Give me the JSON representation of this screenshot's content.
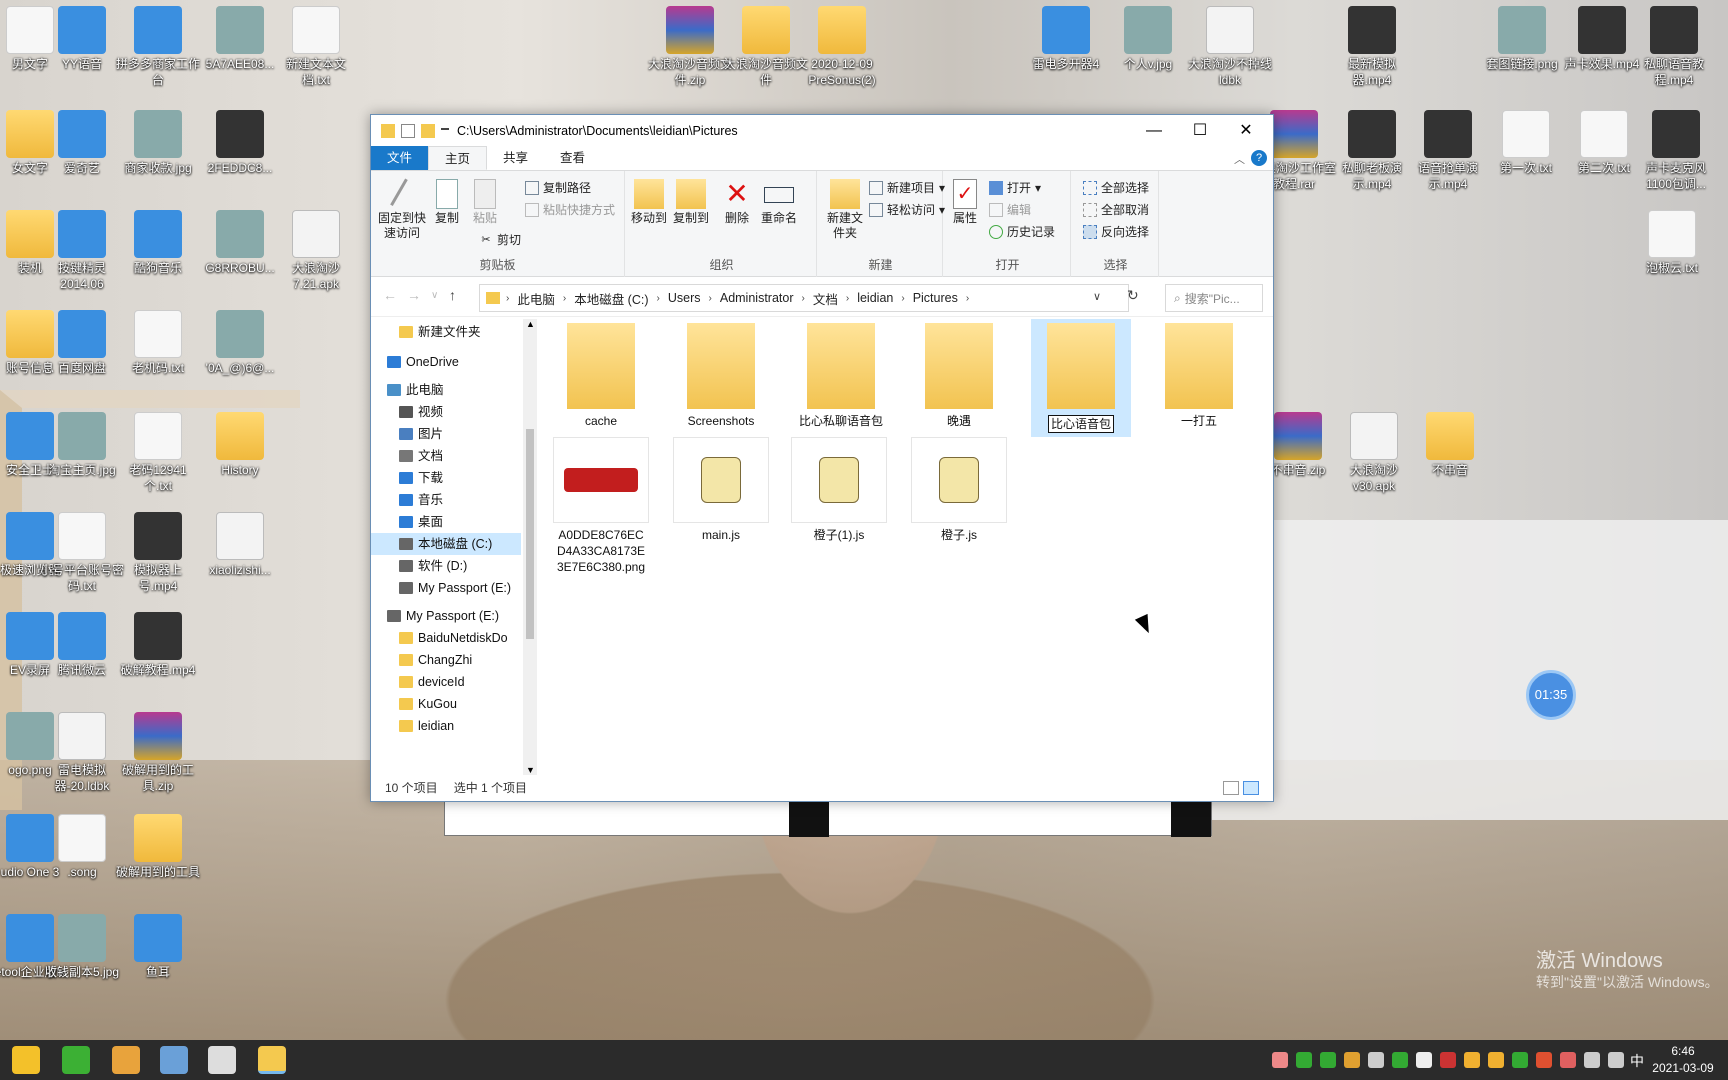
{
  "desktop": {
    "icons": [
      {
        "label": "男文字",
        "type": "doc"
      },
      {
        "label": "YY语音",
        "type": "app"
      },
      {
        "label": "拼多多商家工作台",
        "type": "app"
      },
      {
        "label": "5A7AEE08...",
        "type": "img"
      },
      {
        "label": "新建文本文档.txt",
        "type": "doc"
      },
      {
        "label": "大浪淘沙音频文件.zip",
        "type": "rar"
      },
      {
        "label": "大浪淘沙音频文件",
        "type": "folder"
      },
      {
        "label": "2020-12-09 PreSonus(2)",
        "type": "folder"
      },
      {
        "label": "雷电多开器4",
        "type": "app"
      },
      {
        "label": "个人v.jpg",
        "type": "img"
      },
      {
        "label": "大浪淘沙不掉线ldbk",
        "type": "apk"
      },
      {
        "label": "最新模拟器.mp4",
        "type": "video"
      },
      {
        "label": "套图链接.png",
        "type": "img"
      },
      {
        "label": "声卡效果.mp4",
        "type": "video"
      },
      {
        "label": "私聊语音教程.mp4",
        "type": "video"
      },
      {
        "label": "女文字",
        "type": "folder"
      },
      {
        "label": "爱奇艺",
        "type": "app"
      },
      {
        "label": "商家收款.jpg",
        "type": "img"
      },
      {
        "label": "2FEDDC8...",
        "type": "video"
      },
      {
        "label": "大浪淘沙工作室教程.rar",
        "type": "rar"
      },
      {
        "label": "私聊老板演示.mp4",
        "type": "video"
      },
      {
        "label": "语音抢单演示.mp4",
        "type": "video"
      },
      {
        "label": "第一次.txt",
        "type": "doc"
      },
      {
        "label": "第二次.txt",
        "type": "doc"
      },
      {
        "label": "声卡麦克风1100包调...",
        "type": "video"
      },
      {
        "label": "装机",
        "type": "folder"
      },
      {
        "label": "按键精灵2014.06",
        "type": "app"
      },
      {
        "label": "酷狗音乐",
        "type": "app"
      },
      {
        "label": "G8RROBU...",
        "type": "img"
      },
      {
        "label": "大浪淘沙7.21.apk",
        "type": "apk"
      },
      {
        "label": "泡椒云.txt",
        "type": "doc"
      },
      {
        "label": "账号信息",
        "type": "folder"
      },
      {
        "label": "百度网盘",
        "type": "app"
      },
      {
        "label": "老机码.txt",
        "type": "doc"
      },
      {
        "label": "'0A_@)6@...",
        "type": "img"
      },
      {
        "label": "安全卫士",
        "type": "app"
      },
      {
        "label": "淘宝主页.jpg",
        "type": "img"
      },
      {
        "label": "老码12941个.txt",
        "type": "doc"
      },
      {
        "label": "History",
        "type": "folder"
      },
      {
        "label": "不串音.zip",
        "type": "rar"
      },
      {
        "label": "大浪淘沙v30.apk",
        "type": "apk"
      },
      {
        "label": "不串音",
        "type": "folder"
      },
      {
        "label": "极速浏览器",
        "type": "app"
      },
      {
        "label": "小号平台账号密码.txt",
        "type": "doc"
      },
      {
        "label": "模拟器上号.mp4",
        "type": "video"
      },
      {
        "label": "xiaolizishi...",
        "type": "apk"
      },
      {
        "label": "EV录屏",
        "type": "app"
      },
      {
        "label": "腾讯微云",
        "type": "app"
      },
      {
        "label": "破解教程.mp4",
        "type": "video"
      },
      {
        "label": "ogo.png",
        "type": "img"
      },
      {
        "label": "雷电模拟器-20.ldbk",
        "type": "apk"
      },
      {
        "label": "破解用到的工具.zip",
        "type": "rar"
      },
      {
        "label": "udio One 3",
        "type": "app"
      },
      {
        "label": ".song",
        "type": "doc"
      },
      {
        "label": "破解用到的工具",
        "type": "folder"
      },
      {
        "label": "etool企业版lx",
        "type": "app"
      },
      {
        "label": "收钱副本5.jpg",
        "type": "img"
      },
      {
        "label": "鱼耳",
        "type": "app"
      }
    ],
    "timer": "01:35",
    "activation_title": "激活 Windows",
    "activation_sub": "转到\"设置\"以激活 Windows。"
  },
  "explorer": {
    "title_path": "C:\\Users\\Administrator\\Documents\\leidian\\Pictures",
    "window_controls": {
      "minimize": "—",
      "maximize": "☐",
      "close": "✕"
    },
    "tabs": [
      "文件",
      "主页",
      "共享",
      "查看"
    ],
    "ribbon": {
      "clipboard": {
        "pin": "固定到快速访问",
        "copy": "复制",
        "paste": "粘贴",
        "copy_path": "复制路径",
        "paste_shortcut": "粘贴快捷方式",
        "cut": "剪切",
        "label": "剪贴板"
      },
      "organize": {
        "move_to": "移动到",
        "copy_to": "复制到",
        "delete": "删除",
        "rename": "重命名",
        "label": "组织"
      },
      "new": {
        "new_folder": "新建文件夹",
        "new_item": "新建项目",
        "easy_access": "轻松访问",
        "label": "新建"
      },
      "open": {
        "properties": "属性",
        "open": "打开",
        "edit": "编辑",
        "history": "历史记录",
        "label": "打开"
      },
      "select": {
        "select_all": "全部选择",
        "select_none": "全部取消",
        "invert": "反向选择",
        "label": "选择"
      }
    },
    "breadcrumb": [
      "此电脑",
      "本地磁盘 (C:)",
      "Users",
      "Administrator",
      "文档",
      "leidian",
      "Pictures"
    ],
    "search_placeholder": "搜索\"Pic...",
    "nav": [
      {
        "label": "新建文件夹",
        "kind": "folder"
      },
      {
        "label": "OneDrive",
        "kind": "cloud"
      },
      {
        "label": "此电脑",
        "kind": "pc"
      },
      {
        "label": "视频",
        "kind": "video"
      },
      {
        "label": "图片",
        "kind": "pic"
      },
      {
        "label": "文档",
        "kind": "doc"
      },
      {
        "label": "下载",
        "kind": "down"
      },
      {
        "label": "音乐",
        "kind": "music"
      },
      {
        "label": "桌面",
        "kind": "desk"
      },
      {
        "label": "本地磁盘 (C:)",
        "kind": "drive"
      },
      {
        "label": "软件 (D:)",
        "kind": "drive"
      },
      {
        "label": "My Passport (E:)",
        "kind": "drive"
      },
      {
        "label": "My Passport (E:)",
        "kind": "drive"
      },
      {
        "label": "BaiduNetdiskDo",
        "kind": "folder"
      },
      {
        "label": "ChangZhi",
        "kind": "folder"
      },
      {
        "label": "deviceId",
        "kind": "folder"
      },
      {
        "label": "KuGou",
        "kind": "folder"
      },
      {
        "label": "leidian",
        "kind": "folder"
      }
    ],
    "files": [
      {
        "name": "cache",
        "kind": "folder"
      },
      {
        "name": "Screenshots",
        "kind": "folder"
      },
      {
        "name": "比心私聊语音包",
        "kind": "folder"
      },
      {
        "name": "晚遇",
        "kind": "folder"
      },
      {
        "name": "比心语音包",
        "kind": "folder",
        "selected": true,
        "renaming": true
      },
      {
        "name": "一打五",
        "kind": "folder"
      },
      {
        "name": "A0DDE8C76ECD4A33CA8173E3E7E6C380.png",
        "kind": "png",
        "line1": "A0DDE8C76EC",
        "line2": "D4A33CA8173E",
        "line3": "3E7E6C380.png"
      },
      {
        "name": "main.js",
        "kind": "js"
      },
      {
        "name": "橙子(1).js",
        "kind": "js"
      },
      {
        "name": "橙子.js",
        "kind": "js"
      }
    ],
    "status_count": "10 个项目",
    "status_selected": "选中 1 个项目"
  },
  "taskbar": {
    "clock_time": "6:46",
    "clock_date": "2021-03-09",
    "ime": "中"
  }
}
